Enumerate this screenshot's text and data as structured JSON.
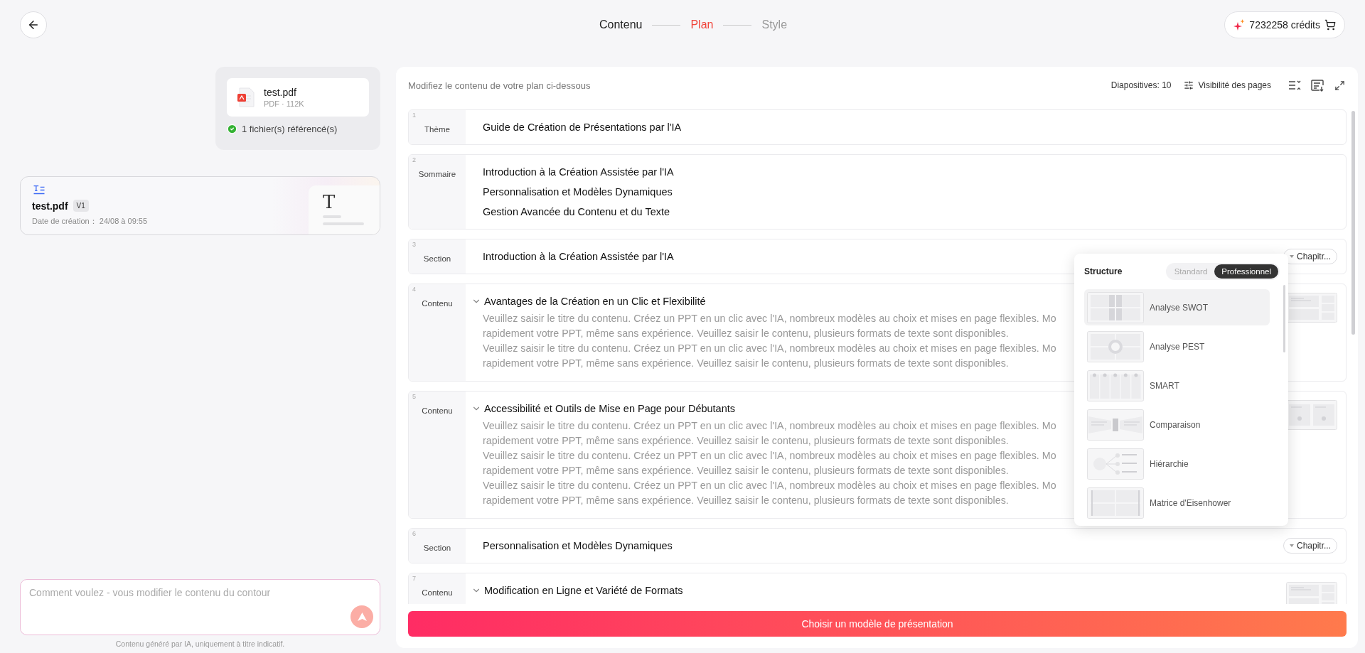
{
  "header": {
    "steps": [
      {
        "label": "Contenu",
        "selected": false
      },
      {
        "label": "Plan",
        "selected": true
      },
      {
        "label": "Style",
        "selected": false
      }
    ],
    "credits": "7232258 crédits"
  },
  "left": {
    "attachment": {
      "name": "test.pdf",
      "meta": "PDF · 112K",
      "status": "1 fichier(s) référencé(s)"
    },
    "document": {
      "name": "test.pdf",
      "version": "V1",
      "date_label": "Date de création：",
      "date": "24/08 à 09:55",
      "preview_glyph": "T"
    },
    "prompt": {
      "placeholder": "Comment voulez - vous modifier le contenu du contour"
    },
    "disclaimer": "Contenu généré par IA, uniquement à titre indicatif."
  },
  "outline": {
    "instruction": "Modifiez le contenu de votre plan ci-dessous",
    "slides_count": "Diapositives: 10",
    "visibility": "Visibilité des pages",
    "rows": [
      {
        "number": "1",
        "kind": "plain",
        "label": "Thème",
        "lines": [
          "Guide de Création de Présentations par l'IA"
        ]
      },
      {
        "number": "2",
        "kind": "plain",
        "label": "Sommaire",
        "lines": [
          "Introduction à la Création Assistée par l'IA",
          "Personnalisation et Modèles Dynamiques",
          "Gestion Avancée du Contenu et du Texte"
        ]
      },
      {
        "number": "3",
        "kind": "section",
        "label": "Section",
        "lines": [
          "Introduction à la Création Assistée par l'IA"
        ],
        "chapter": "Chapitr..."
      },
      {
        "number": "4",
        "kind": "content",
        "label": "Contenu",
        "title": "Avantages de la Création en un Clic et Flexibilité",
        "expanded": true,
        "lines": [
          "Veuillez saisir le titre du contenu. Créez un PPT en un clic avec l'IA, nombreux modèles au choix et mises en page flexibles. Mo",
          "rapidement votre PPT, même sans expérience. Veuillez saisir le contenu, plusieurs formats de texte sont disponibles.",
          "Veuillez saisir le titre du contenu. Créez un PPT en un clic avec l'IA, nombreux modèles au choix et mises en page flexibles. Mo",
          "rapidement votre PPT, même sans expérience. Veuillez saisir le contenu, plusieurs formats de texte sont disponibles."
        ]
      },
      {
        "number": "5",
        "kind": "content",
        "label": "Contenu",
        "title": "Accessibilité et Outils de Mise en Page pour Débutants",
        "expanded": true,
        "lines": [
          "Veuillez saisir le titre du contenu. Créez un PPT en un clic avec l'IA, nombreux modèles au choix et mises en page flexibles. Mo",
          "rapidement votre PPT, même sans expérience. Veuillez saisir le contenu, plusieurs formats de texte sont disponibles.",
          "Veuillez saisir le titre du contenu. Créez un PPT en un clic avec l'IA, nombreux modèles au choix et mises en page flexibles. Mo",
          "rapidement votre PPT, même sans expérience. Veuillez saisir le contenu, plusieurs formats de texte sont disponibles.",
          "Veuillez saisir le titre du contenu. Créez un PPT en un clic avec l'IA, nombreux modèles au choix et mises en page flexibles. Mo",
          "rapidement votre PPT, même sans expérience. Veuillez saisir le contenu, plusieurs formats de texte sont disponibles."
        ]
      },
      {
        "number": "6",
        "kind": "section",
        "label": "Section",
        "lines": [
          "Personnalisation et Modèles Dynamiques"
        ],
        "chapter": "Chapitr..."
      },
      {
        "number": "7",
        "kind": "content",
        "label": "Contenu",
        "title": "Modification en Ligne et Variété de Formats",
        "expanded": true
      }
    ],
    "submit": "Choisir un modèle de présentation"
  },
  "structure_menu": {
    "title": "Structure",
    "modes": [
      {
        "label": "Standard",
        "selected": false
      },
      {
        "label": "Professionnel",
        "selected": true
      }
    ],
    "items": [
      {
        "kind": "swot",
        "label": "Analyse SWOT",
        "selected": true
      },
      {
        "kind": "pest",
        "label": "Analyse PEST",
        "selected": false
      },
      {
        "kind": "smart",
        "label": "SMART",
        "selected": false
      },
      {
        "kind": "comparison",
        "label": "Comparaison",
        "selected": false
      },
      {
        "kind": "hierarchy",
        "label": "Hiérarchie",
        "selected": false
      },
      {
        "kind": "matrix",
        "label": "Matrice d'Eisenhower",
        "selected": false
      }
    ]
  }
}
